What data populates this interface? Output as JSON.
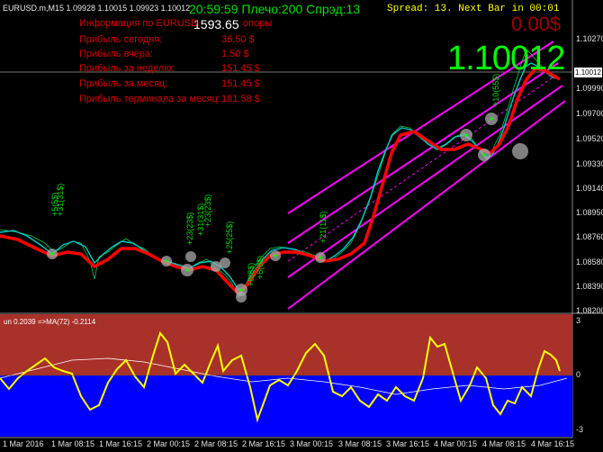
{
  "header": {
    "symbol_line": "EURUSD.m,M15  1.09928 1.10015 1.09923 1.10012",
    "time_line": "20:59:59 Плечо:200 Спрэд:13",
    "spread_line": "Spread: 13. Next Bar in 00:01"
  },
  "overlay": {
    "profit_big": "0.00$",
    "big_price": "1.10012",
    "position_value": "1593.65"
  },
  "info_panel": {
    "rows": [
      {
        "label": "Информация по EURUSD",
        "value": "опоры"
      },
      {
        "label": "Прибыль сегодня:",
        "value": "36.50 $"
      },
      {
        "label": "Прибыль вчера:",
        "value": "1.50 $"
      },
      {
        "label": "Прибыль за неделю:",
        "value": "151.45 $"
      },
      {
        "label": "Прибыль за месяц:",
        "value": "151.45 $"
      },
      {
        "label": "Прибыль терминала за месяц:",
        "value": "181.58 $"
      }
    ]
  },
  "price_axis": {
    "ticks": [
      "1.10270",
      "1.10012",
      "1.09990",
      "1.09700",
      "1.09520",
      "1.09330",
      "1.09140",
      "1.08950",
      "1.08760",
      "1.08580",
      "1.08390",
      "1.08200"
    ],
    "current_price": "1.10012"
  },
  "indicator": {
    "label": "un 0.2039  =>MA(72) -0.2114",
    "ticks": [
      "3",
      "0",
      "-3"
    ],
    "colors": {
      "upper_zone": "#a8312a",
      "lower_zone": "#0000ff",
      "line": "#ffff00",
      "ma": "#ffffff"
    }
  },
  "time_axis": {
    "ticks": [
      "1 Mar 2016",
      "1 Mar 08:15",
      "1 Mar 16:15",
      "2 Mar 00:15",
      "2 Mar 08:15",
      "2 Mar 16:15",
      "3 Mar 00:15",
      "3 Mar 08:15",
      "3 Mar 16:15",
      "4 Mar 00:15",
      "4 Mar 08:15",
      "4 Mar 16:15"
    ]
  },
  "signals": [
    "+5(5$)",
    "+31(31$)",
    "+23(23$)",
    "+25(25$)",
    "+8(8$)",
    "+21(11$)",
    "+10(55$)"
  ],
  "colors": {
    "background": "#000000",
    "price_line": "#00c8c8",
    "ma_line": "#ff0000",
    "channel": "#ff00ff",
    "text_red": "#d40000",
    "text_green": "#00ff00"
  }
}
